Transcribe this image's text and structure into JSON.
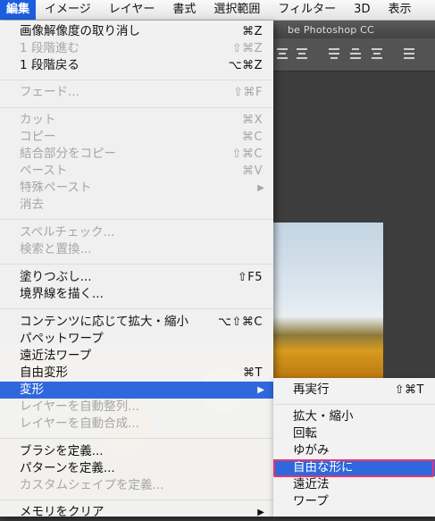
{
  "menubar": {
    "items": [
      {
        "label": "編集",
        "active": true
      },
      {
        "label": "イメージ"
      },
      {
        "label": "レイヤー"
      },
      {
        "label": "書式"
      },
      {
        "label": "選択範囲"
      },
      {
        "label": "フィルター"
      },
      {
        "label": "3D"
      },
      {
        "label": "表示"
      }
    ]
  },
  "background_app": {
    "title_fragment": "be Photoshop CC"
  },
  "edit_menu": {
    "items": [
      {
        "label": "画像解像度の取り消し",
        "shortcut": "⌘Z"
      },
      {
        "label": "1 段階進む",
        "shortcut": "⇧⌘Z",
        "disabled": true
      },
      {
        "label": "1 段階戻る",
        "shortcut": "⌥⌘Z"
      },
      {
        "label": "フェード...",
        "shortcut": "⇧⌘F",
        "disabled": true
      },
      {
        "label": "カット",
        "shortcut": "⌘X",
        "disabled": true
      },
      {
        "label": "コピー",
        "shortcut": "⌘C",
        "disabled": true
      },
      {
        "label": "結合部分をコピー",
        "shortcut": "⇧⌘C",
        "disabled": true
      },
      {
        "label": "ペースト",
        "shortcut": "⌘V",
        "disabled": true
      },
      {
        "label": "特殊ペースト",
        "submenu": true,
        "disabled": true
      },
      {
        "label": "消去",
        "disabled": true
      },
      {
        "label": "スペルチェック...",
        "disabled": true
      },
      {
        "label": "検索と置換...",
        "disabled": true
      },
      {
        "label": "塗りつぶし...",
        "shortcut": "⇧F5"
      },
      {
        "label": "境界線を描く..."
      },
      {
        "label": "コンテンツに応じて拡大・縮小",
        "shortcut": "⌥⇧⌘C"
      },
      {
        "label": "パペットワープ"
      },
      {
        "label": "遠近法ワープ"
      },
      {
        "label": "自由変形",
        "shortcut": "⌘T"
      },
      {
        "label": "変形",
        "submenu": true,
        "highlight": true
      },
      {
        "label": "レイヤーを自動整列...",
        "disabled": true
      },
      {
        "label": "レイヤーを自動合成...",
        "disabled": true
      },
      {
        "label": "ブラシを定義..."
      },
      {
        "label": "パターンを定義..."
      },
      {
        "label": "カスタムシェイプを定義...",
        "disabled": true
      },
      {
        "label": "メモリをクリア",
        "submenu": true
      }
    ]
  },
  "transform_submenu": {
    "items": [
      {
        "label": "再実行",
        "shortcut": "⇧⌘T"
      },
      {
        "label": "拡大・縮小"
      },
      {
        "label": "回転"
      },
      {
        "label": "ゆがみ"
      },
      {
        "label": "自由な形に",
        "highlight": true
      },
      {
        "label": "遠近法"
      },
      {
        "label": "ワープ"
      }
    ]
  },
  "colors": {
    "menu_highlight": "#2f68dc",
    "callout_border": "#e8346f",
    "disabled_text": "#a6a6a6"
  }
}
